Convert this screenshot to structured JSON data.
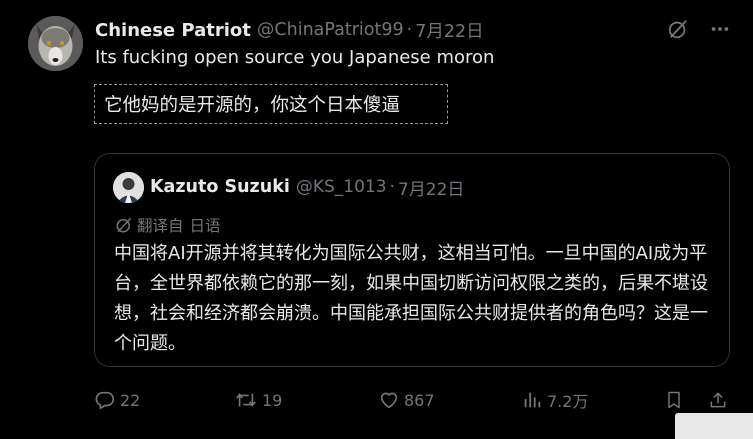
{
  "author": {
    "display_name": "Chinese Patriot",
    "handle": "@ChinaPatriot99",
    "separator": "·",
    "date": "7月22日"
  },
  "tweet": {
    "text": "Its fucking open source you Japanese moron",
    "translation": "它他妈的是开源的，你这个日本傻逼"
  },
  "quoted": {
    "display_name": "Kazuto Suzuki",
    "handle": "@KS_1013",
    "separator": "·",
    "date": "7月22日",
    "translated_from_label": "翻译自",
    "translated_from_lang": "日语",
    "body": "中国将AI开源并将其转化为国际公共财，这相当可怕。一旦中国的AI成为平台，全世界都依赖它的那一刻，如果中国切断访问权限之类的，后果不堪设想，社会和经济都会崩溃。中国能承担国际公共财提供者的角色吗？这是一个问题。"
  },
  "actions": {
    "replies": "22",
    "retweets": "19",
    "likes": "867",
    "views": "7.2万"
  },
  "icons": {
    "avatar": "wolf-avatar",
    "quote_avatar": "person-avatar",
    "grok": "grok-icon",
    "more": "more-icon",
    "translate": "translate-icon",
    "reply": "reply-icon",
    "retweet": "retweet-icon",
    "like": "heart-icon",
    "views": "views-icon",
    "bookmark": "bookmark-icon",
    "share": "share-icon"
  },
  "colors": {
    "background": "#000000",
    "text": "#e7e9ea",
    "muted": "#71767b",
    "border": "#2f3336"
  }
}
